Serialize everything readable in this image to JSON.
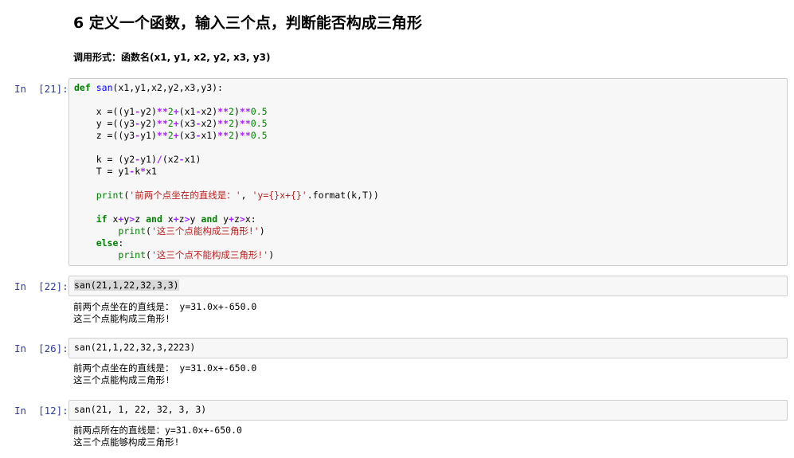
{
  "markdown": {
    "title": "6  定义一个函数，输入三个点，判断能否构成三角形",
    "subtitle": "调用形式：函数名(x1, y1, x2, y2, x3, y3)"
  },
  "cells": [
    {
      "prompt": "In  [21]:",
      "code": {
        "def_kw": "def",
        "fname": "san",
        "params": "(x1,y1,x2,y2,x3,y3):",
        "x_lhs": "x =((y1",
        "z_lhs": "z =((y3",
        "y_lhs": "y =((y3",
        "minus": "-",
        "plus": "+",
        "pow": "**",
        "slash": "/",
        "y2": "y2",
        "y1": "y1",
        "x1": "x1",
        "x2": "x2",
        "x3": "x3",
        "two": "2",
        "half": "0.5",
        "k_lhs": "k = (y2",
        "t_lhs": "T = y1",
        "k_var": "k",
        "star": "*",
        "print": "print",
        "str1": "'前两个点坐在的直线是：'",
        "str2": "'y={}x+{}'",
        "fmt": ".format(k,T))",
        "if_kw": "if",
        "and_kw": "and",
        "else_kw": "else",
        "str_yes": "'这三个点能构成三角形!'",
        "str_no": "'这三个点不能构成三角形!'"
      }
    },
    {
      "prompt": "In  [22]:",
      "code": "san(21,1,22,32,3,3)",
      "output": "前两个点坐在的直线是： y=31.0x+-650.0\n这三个点能构成三角形!"
    },
    {
      "prompt": "In  [26]:",
      "code": "san(21,1,22,32,3,2223)",
      "output": "前两个点坐在的直线是： y=31.0x+-650.0\n这三个点能构成三角形!"
    },
    {
      "prompt": "In  [12]:",
      "code": "san(21, 1, 22, 32, 3, 3)",
      "output": "前两点所在的直线是：y=31.0x+-650.0\n这三个点能够构成三角形!"
    }
  ]
}
